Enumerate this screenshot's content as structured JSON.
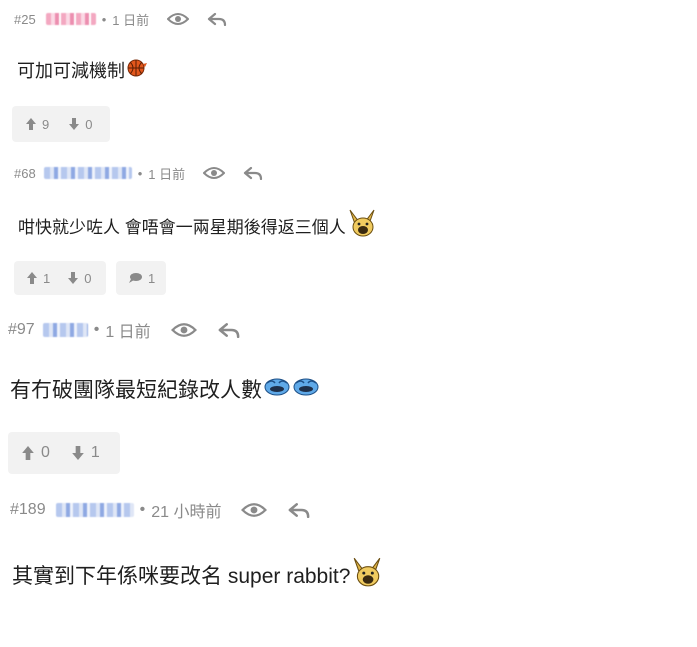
{
  "posts": [
    {
      "number": "#25",
      "time": "1 日前",
      "content": "可加可減機制",
      "votes": {
        "up": "9",
        "down": "0"
      }
    },
    {
      "number": "#68",
      "time": "1 日前",
      "content": "咁快就少咗人 會唔會一兩星期後得返三個人",
      "votes": {
        "up": "1",
        "down": "0"
      },
      "replies": "1"
    },
    {
      "number": "#97",
      "time": "1 日前",
      "content": "有冇破團隊最短紀錄改人數",
      "votes": {
        "up": "0",
        "down": "1"
      }
    },
    {
      "number": "#189",
      "time": "21 小時前",
      "content": "其實到下年係咪要改名 super rabbit?"
    }
  ],
  "meta_separator": "•",
  "icons": {
    "view": "eye-icon",
    "reply": "reply-arrow-icon",
    "upvote": "arrow-up-icon",
    "downvote": "arrow-down-icon",
    "comments": "speech-bubble-icon"
  },
  "colors": {
    "meta_text": "#8a8a8a",
    "content_text": "#1f1f1f",
    "vote_bg": "#f2f2f2",
    "name_blur_pink": "#f3a8c1",
    "name_blur_blue": "#b6c8ee"
  }
}
